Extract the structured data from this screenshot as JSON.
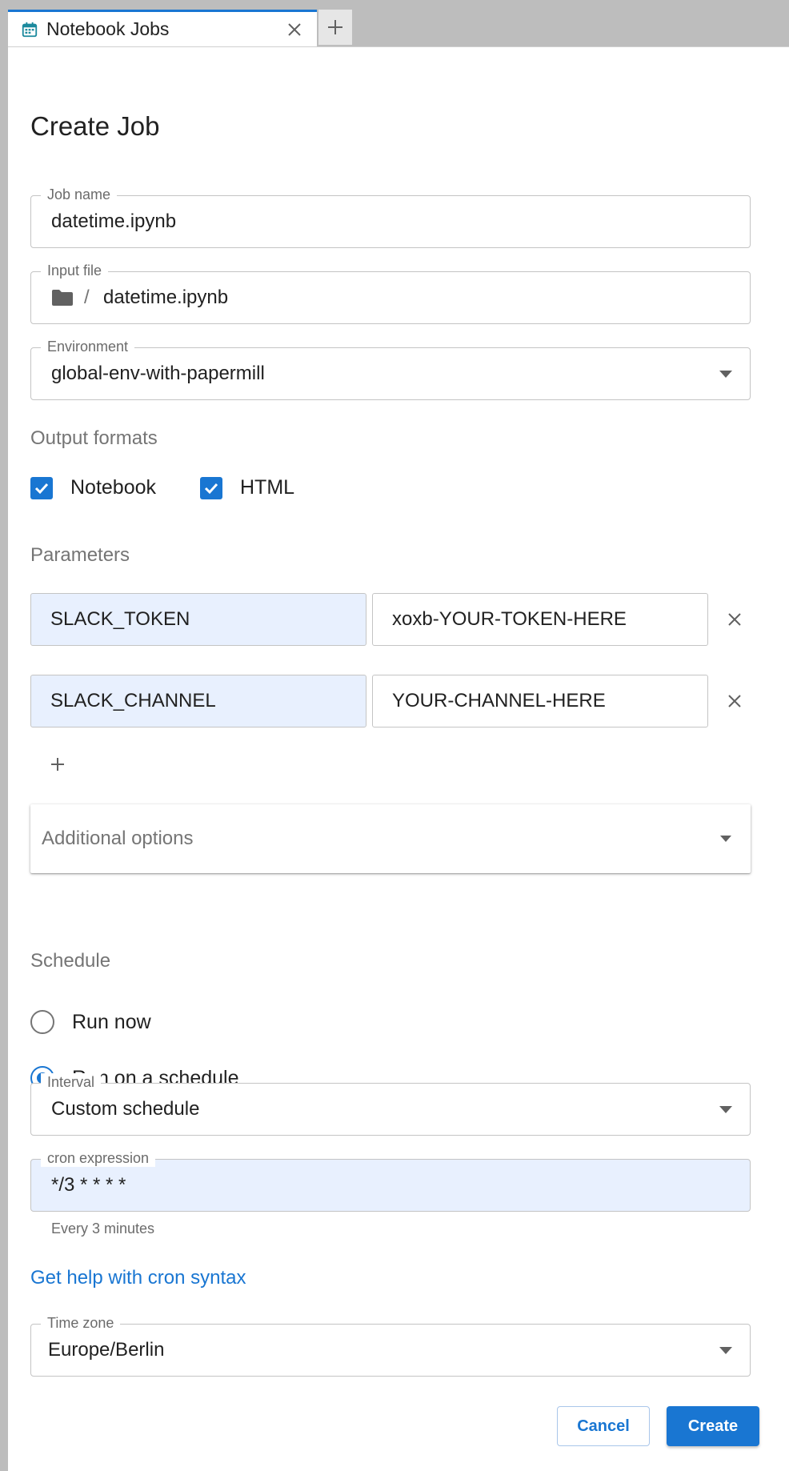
{
  "tab": {
    "title": "Notebook Jobs"
  },
  "page": {
    "title": "Create Job"
  },
  "job_name": {
    "label": "Job name",
    "value": "datetime.ipynb"
  },
  "input_file": {
    "label": "Input file",
    "separator": "/",
    "value": "datetime.ipynb"
  },
  "environment": {
    "label": "Environment",
    "value": "global-env-with-papermill"
  },
  "output_formats": {
    "label": "Output formats",
    "options": [
      {
        "label": "Notebook",
        "checked": true
      },
      {
        "label": "HTML",
        "checked": true
      }
    ]
  },
  "parameters": {
    "label": "Parameters",
    "items": [
      {
        "key": "SLACK_TOKEN",
        "value": "xoxb-YOUR-TOKEN-HERE"
      },
      {
        "key": "SLACK_CHANNEL",
        "value": "YOUR-CHANNEL-HERE"
      }
    ]
  },
  "additional_options": {
    "label": "Additional options"
  },
  "schedule": {
    "label": "Schedule",
    "options": [
      {
        "label": "Run now",
        "selected": false
      },
      {
        "label": "Run on a schedule",
        "selected": true
      }
    ]
  },
  "interval": {
    "label": "Interval",
    "value": "Custom schedule"
  },
  "cron": {
    "label": "cron expression",
    "value": "*/3 * * * *",
    "helper": "Every 3 minutes"
  },
  "cron_help_link": {
    "label": "Get help with cron syntax"
  },
  "time_zone": {
    "label": "Time zone",
    "value": "Europe/Berlin"
  },
  "actions": {
    "cancel": "Cancel",
    "create": "Create"
  },
  "colors": {
    "accent": "#1976d2",
    "filled_input": "#e8f0fe",
    "tabbar": "#bdbdbd"
  },
  "icons": {
    "tab": "calendar-icon",
    "close": "close-icon",
    "new_tab": "plus-icon",
    "folder": "folder-icon",
    "dropdown": "caret-down-icon",
    "remove": "close-icon",
    "add": "plus-icon"
  }
}
